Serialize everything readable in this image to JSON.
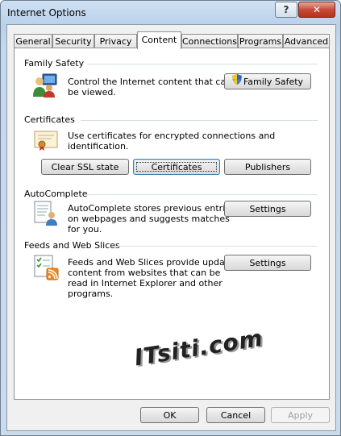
{
  "window": {
    "title": "Internet Options",
    "help_label": "?",
    "close_label": "✕"
  },
  "tabs": [
    {
      "label": "General"
    },
    {
      "label": "Security"
    },
    {
      "label": "Privacy"
    },
    {
      "label": "Content"
    },
    {
      "label": "Connections"
    },
    {
      "label": "Programs"
    },
    {
      "label": "Advanced"
    }
  ],
  "active_tab": "Content",
  "family_safety": {
    "heading": "Family Safety",
    "description_line1": "Control the Internet content that can",
    "description_line2": "be viewed.",
    "button": "Family Safety"
  },
  "certificates": {
    "heading": "Certificates",
    "description": "Use certificates for encrypted connections and identification.",
    "clear_ssl": "Clear SSL state",
    "certificates_btn": "Certificates",
    "publishers": "Publishers"
  },
  "autocomplete": {
    "heading": "AutoComplete",
    "line1": "AutoComplete stores previous entries",
    "line2": "on webpages and suggests matches",
    "line3": "for you.",
    "settings": "Settings"
  },
  "feeds": {
    "heading": "Feeds and Web Slices",
    "line1": "Feeds and Web Slices provide updated",
    "line2": "content from websites that can be",
    "line3": "read in Internet Explorer and other",
    "line4": "programs.",
    "settings": "Settings"
  },
  "watermark": "ITsiti.com",
  "footer": {
    "ok": "OK",
    "cancel": "Cancel",
    "apply": "Apply"
  }
}
